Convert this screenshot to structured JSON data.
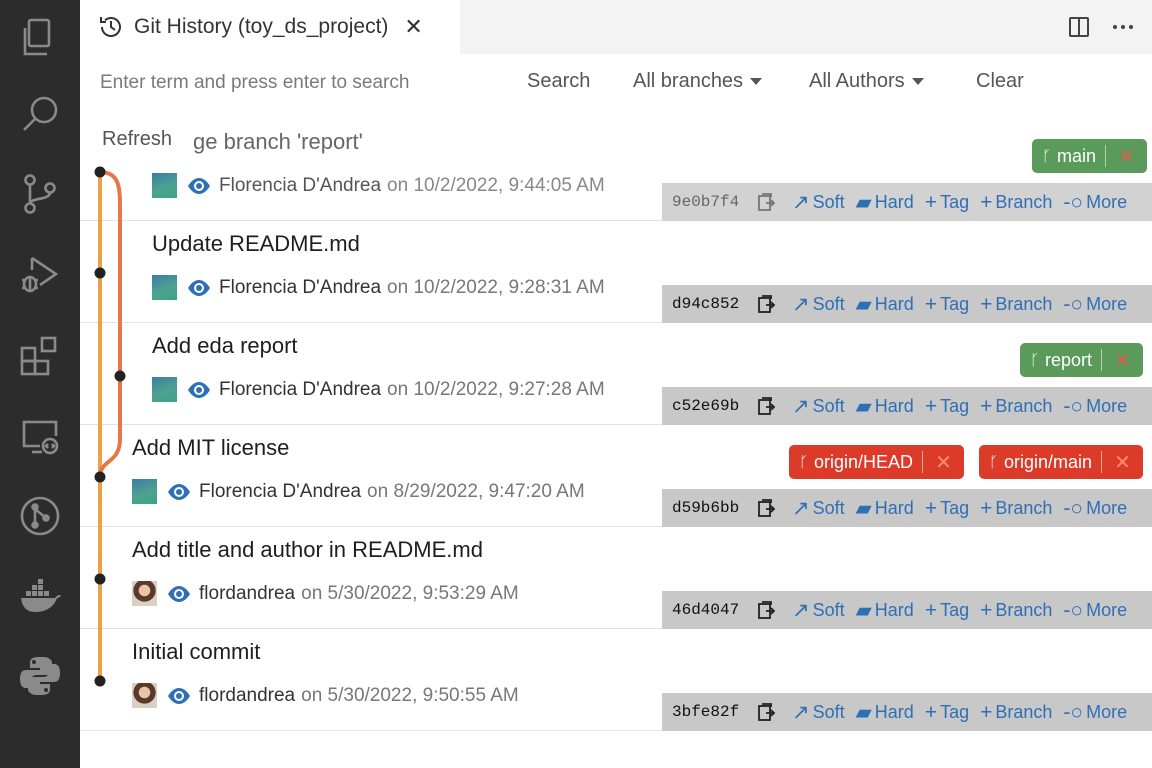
{
  "tab": {
    "title": "Git History (toy_ds_project)"
  },
  "toolbar": {
    "search_placeholder": "Enter term and press enter to search",
    "search_label": "Search",
    "branches_label": "All branches",
    "authors_label": "All Authors",
    "clear_label": "Clear",
    "refresh_label": "Refresh"
  },
  "actions": {
    "soft": "Soft",
    "hard": "Hard",
    "tag": "Tag",
    "branch": "Branch",
    "more": "More"
  },
  "commits": [
    {
      "message": "ge branch 'report'",
      "author": "Florencia D'Andrea",
      "date": "on 10/2/2022, 9:44:05 AM",
      "hash": "9e0b7f4",
      "badges": [
        {
          "label": "main"
        }
      ]
    },
    {
      "message": "Update README.md",
      "author": "Florencia D'Andrea",
      "date": "on 10/2/2022, 9:28:31 AM",
      "hash": "d94c852",
      "badges": []
    },
    {
      "message": "Add eda report",
      "author": "Florencia D'Andrea",
      "date": "on 10/2/2022, 9:27:28 AM",
      "hash": "c52e69b",
      "badges": [
        {
          "label": "report"
        }
      ]
    },
    {
      "message": "Add MIT license",
      "author": "Florencia D'Andrea",
      "date": "on 8/29/2022, 9:47:20 AM",
      "hash": "d59b6bb",
      "badges": [
        {
          "label": "origin/HEAD"
        },
        {
          "label": "origin/main"
        }
      ]
    },
    {
      "message": "Add title and author in README.md",
      "author": "flordandrea",
      "date": "on 5/30/2022, 9:53:29 AM",
      "hash": "46d4047",
      "badges": []
    },
    {
      "message": "Initial commit",
      "author": "flordandrea",
      "date": "on 5/30/2022, 9:50:55 AM",
      "hash": "3bfe82f",
      "badges": []
    }
  ],
  "colors": {
    "graph_main": "#f0a044",
    "graph_branch": "#e8764a",
    "badge_green": "#5a9a5a",
    "badge_red": "#dc3b2a",
    "action_link": "#2f6fb5"
  }
}
